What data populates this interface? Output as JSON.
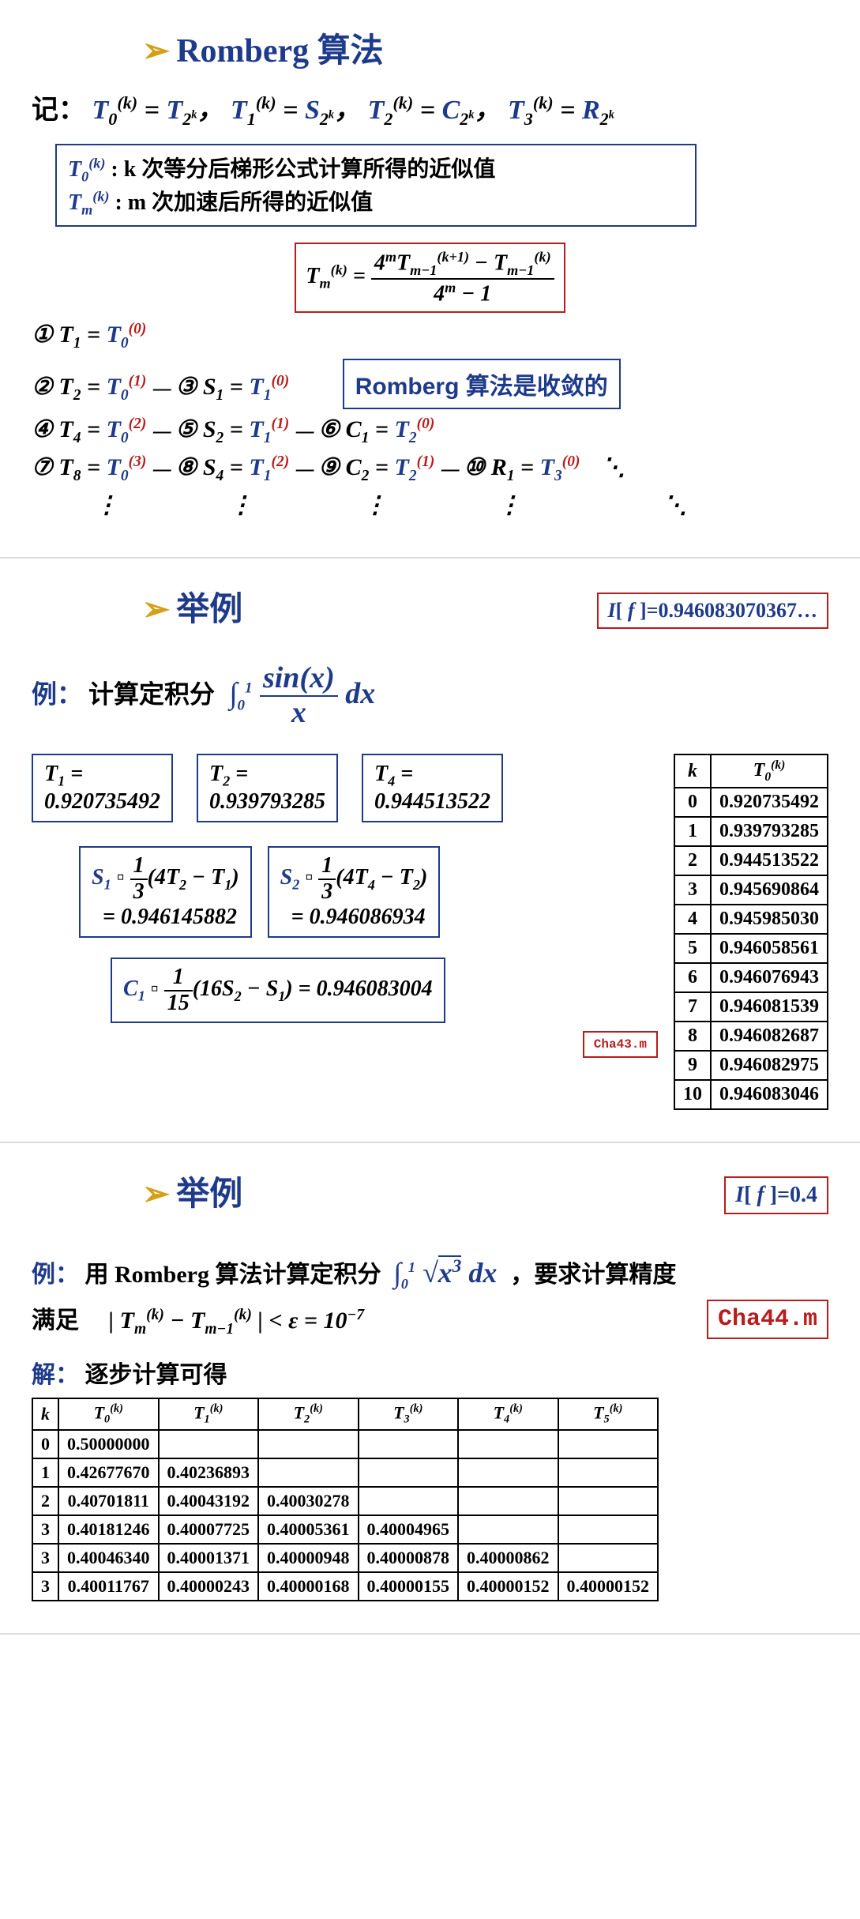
{
  "slide1": {
    "title_arrow": "➢",
    "title": "Romberg 算法",
    "notation_label": "记：",
    "notation": "T₀⁽ᵏ⁾ = T₂ₖ ,  T₁⁽ᵏ⁾ = S₂ₖ ,  T₂⁽ᵏ⁾ = C₂ₖ ,  T₃⁽ᵏ⁾ = R₂ₖ",
    "def1_sym": "T₀⁽ᵏ⁾",
    "def1_text": ": k 次等分后梯形公式计算所得的近似值",
    "def2_sym": "Tₘ⁽ᵏ⁾",
    "def2_text": ": m 次加速后所得的近似值",
    "formula_num": "4ᵐTₘ₋₁⁽ᵏ⁺¹⁾ − Tₘ₋₁⁽ᵏ⁾",
    "formula_den": "4ᵐ − 1",
    "formula_lhs": "Tₘ⁽ᵏ⁾ =",
    "convergence": "Romberg 算法是收敛的",
    "steps": {
      "1": "① T₁ = T₀⁽⁰⁾",
      "2": "② T₂ = T₀⁽¹⁾",
      "3": "③ S₁ = T₁⁽⁰⁾",
      "4": "④ T₄ = T₀⁽²⁾",
      "5": "⑤ S₂ = T₁⁽¹⁾",
      "6": "⑥ C₁ = T₂⁽⁰⁾",
      "7": "⑦ T₈ = T₀⁽³⁾",
      "8": "⑧ S₄ = T₁⁽²⁾",
      "9": "⑨ C₂ = T₂⁽¹⁾",
      "10": "⑩ R₁ = T₃⁽⁰⁾"
    },
    "dots": "⋮"
  },
  "slide2": {
    "title_arrow": "➢",
    "title": "举例",
    "result_label": "I[ f ]=0.946083070367…",
    "example_label": "例：",
    "example_text": "计算定积分",
    "integral_num": "sin(x)",
    "integral_den": "x",
    "integral_dx": "dx",
    "integral_lim_low": "0",
    "integral_lim_high": "1",
    "T1_label": "T₁ =",
    "T1_val": "0.920735492",
    "T2_label": "T₂ =",
    "T2_val": "0.939793285",
    "T4_label": "T₄ =",
    "T4_val": "0.944513522",
    "S1_expr": "S₁ ▫ ⅓(4T₂ − T₁)",
    "S1_val": "= 0.946145882",
    "S2_expr": "S₂ ▫ ⅓(4T₄ − T₂)",
    "S2_val": "= 0.946086934",
    "C1_expr": "C₁ ▫ ¹⁄₁₅(16S₂ − S₁) = 0.946083004",
    "file": "Cha43.m",
    "table_header_k": "k",
    "table_header_T": "T₀⁽ᵏ⁾",
    "table_rows": [
      {
        "k": "0",
        "v": "0.920735492"
      },
      {
        "k": "1",
        "v": "0.939793285"
      },
      {
        "k": "2",
        "v": "0.944513522"
      },
      {
        "k": "3",
        "v": "0.945690864"
      },
      {
        "k": "4",
        "v": "0.945985030"
      },
      {
        "k": "5",
        "v": "0.946058561"
      },
      {
        "k": "6",
        "v": "0.946076943"
      },
      {
        "k": "7",
        "v": "0.946081539"
      },
      {
        "k": "8",
        "v": "0.946082687"
      },
      {
        "k": "9",
        "v": "0.946082975"
      },
      {
        "k": "10",
        "v": "0.946083046"
      }
    ]
  },
  "slide3": {
    "title_arrow": "➢",
    "title": "举例",
    "result_label": "I[ f ]=0.4",
    "example_label": "例：",
    "example_text": "用 Romberg 算法计算定积分",
    "integral": "∫₀¹ √x³ dx",
    "after_text": "，要求计算精度",
    "cond_label": "满足",
    "cond": "| Tₘ⁽ᵏ⁾ − Tₘ₋₁⁽ᵏ⁾ | < ε = 10⁻⁷",
    "file": "Cha44.m",
    "solve_label": "解：",
    "solve_text": "逐步计算可得",
    "headers": [
      "k",
      "T₀⁽ᵏ⁾",
      "T₁⁽ᵏ⁾",
      "T₂⁽ᵏ⁾",
      "T₃⁽ᵏ⁾",
      "T₄⁽ᵏ⁾",
      "T₅⁽ᵏ⁾"
    ],
    "rows": [
      [
        "0",
        "0.50000000",
        "",
        "",
        "",
        "",
        ""
      ],
      [
        "1",
        "0.42677670",
        "0.40236893",
        "",
        "",
        "",
        ""
      ],
      [
        "2",
        "0.40701811",
        "0.40043192",
        "0.40030278",
        "",
        "",
        ""
      ],
      [
        "3",
        "0.40181246",
        "0.40007725",
        "0.40005361",
        "0.40004965",
        "",
        ""
      ],
      [
        "3",
        "0.40046340",
        "0.40001371",
        "0.40000948",
        "0.40000878",
        "0.40000862",
        ""
      ],
      [
        "3",
        "0.40011767",
        "0.40000243",
        "0.40000168",
        "0.40000155",
        "0.40000152",
        "0.40000152"
      ]
    ]
  }
}
